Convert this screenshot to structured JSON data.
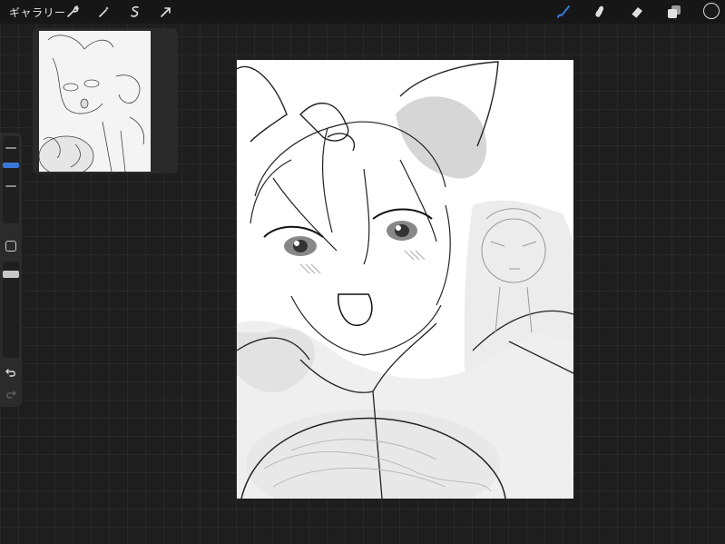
{
  "topbar": {
    "gallery_label": "ギャラリー",
    "left_tools": [
      "wrench-icon",
      "magic-wand-icon",
      "selection-icon",
      "transform-arrow-icon"
    ],
    "right_tools": [
      "brush-icon",
      "smudge-icon",
      "eraser-icon",
      "layers-icon"
    ],
    "active_tool": "brush-icon",
    "active_color": "#1a1a1a",
    "accent_color": "#3a78d8"
  },
  "sidebar": {
    "brush_size_level": 0.45,
    "brush_opacity_level": 0.85,
    "icons": [
      "modify-square-icon",
      "undo-icon",
      "redo-icon"
    ]
  },
  "reference": {
    "title": ""
  }
}
